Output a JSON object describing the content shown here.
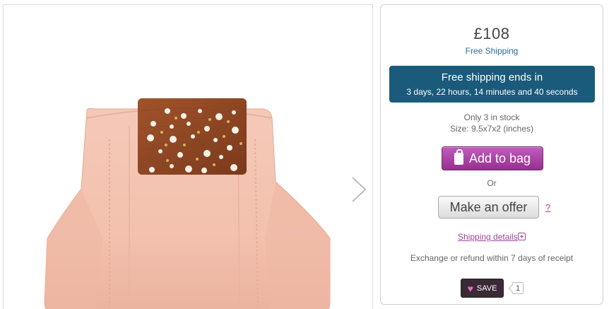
{
  "gallery": {
    "image_alt": "Pink leather clutch with wooden pearl-studded clasp",
    "next_icon": "chevron-right-icon"
  },
  "product": {
    "price": "£108",
    "free_shipping": "Free Shipping",
    "promo": {
      "title": "Free shipping ends in",
      "countdown": "3 days, 22 hours, 14 minutes and 40 seconds"
    },
    "stock": "Only 3 in stock",
    "size": "Size: 9.5x7x2 (inches)",
    "add_to_bag": "Add to bag",
    "or": "Or",
    "make_offer": "Make an offer",
    "offer_help": "?",
    "shipping_details": "Shipping details",
    "exchange": "Exchange or refund within 7 days of receipt",
    "save_label": "SAVE",
    "save_count": "1"
  },
  "colors": {
    "promo_bg": "#1a5a7a",
    "add_to_bag": "#a63ea0",
    "link": "#a0449b",
    "free_shipping": "#2e6a9a"
  },
  "icons": [
    "bag-icon",
    "plus-icon",
    "heart-icon",
    "chevron-right-icon"
  ]
}
